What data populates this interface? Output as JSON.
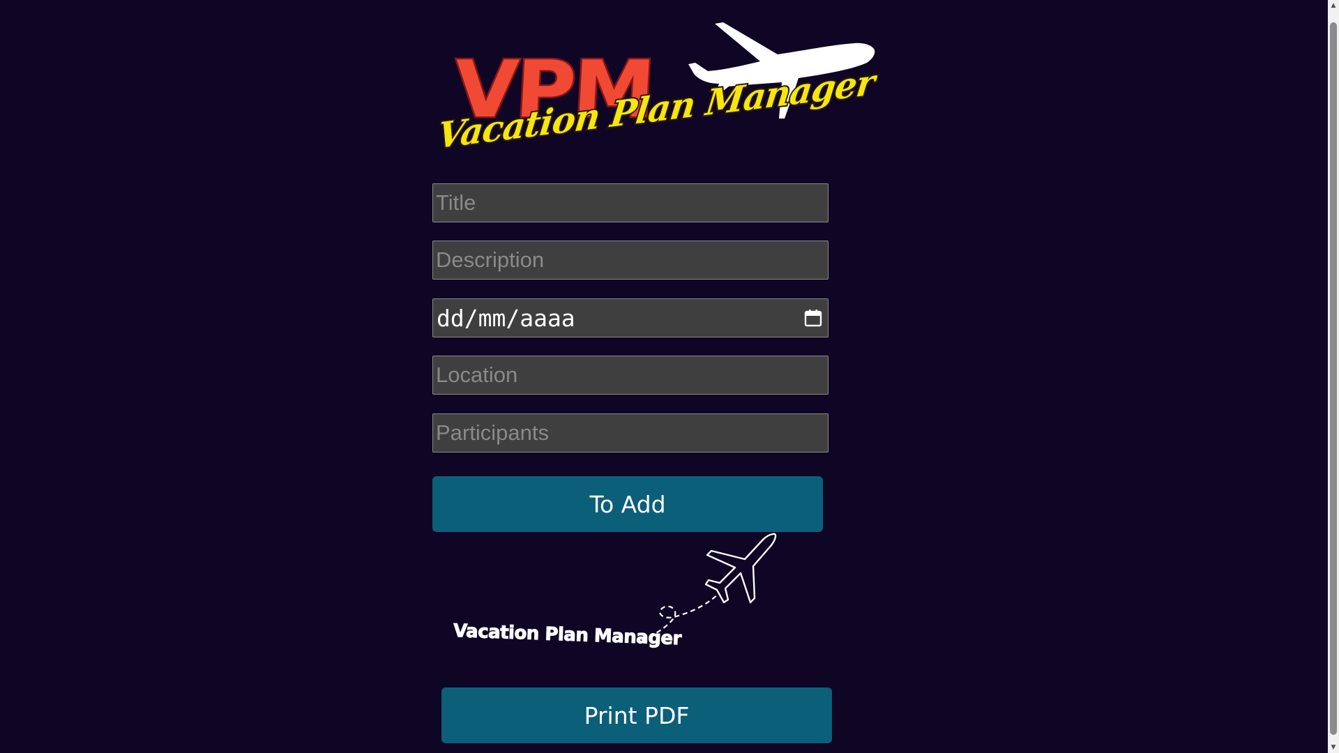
{
  "logo": {
    "abbr": "VPM",
    "tagline": "Vacation Plan Manager",
    "plane_icon": "airplane-icon"
  },
  "form": {
    "title_placeholder": "Title",
    "description_placeholder": "Description",
    "date_value": "dd/mm/aaaa",
    "date_icon": "calendar-icon",
    "location_placeholder": "Location",
    "participants_placeholder": "Participants"
  },
  "buttons": {
    "add_label": "To Add",
    "pdf_label": "Print PDF"
  },
  "footer_logo": {
    "tagline": "Vacation Plan Manager",
    "plane_icon": "airplane-outline-icon"
  },
  "colors": {
    "background": "#0f0626",
    "button": "#0c5f78",
    "field": "#3f3f3f",
    "logo_red": "#f04a34",
    "logo_yellow": "#f5e60f"
  }
}
